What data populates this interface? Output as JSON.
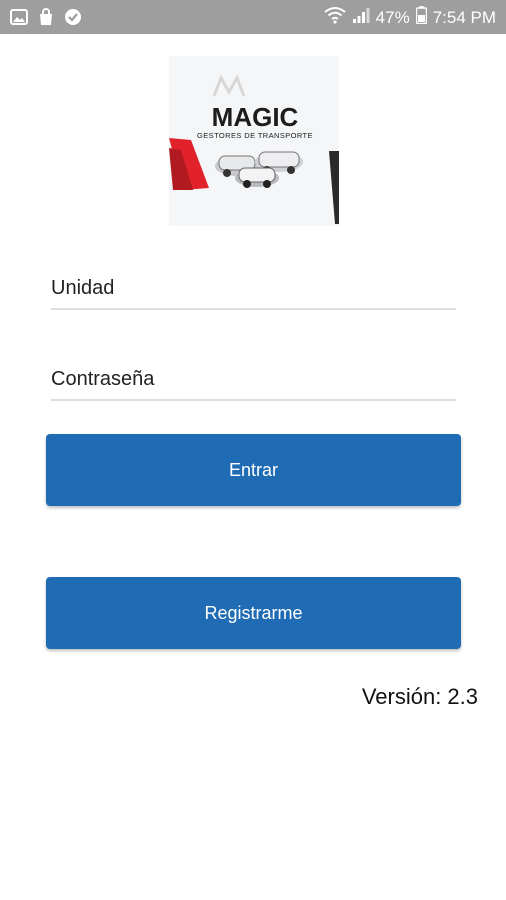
{
  "status_bar": {
    "battery_percent": "47%",
    "time": "7:54 PM",
    "left_icons": [
      "gallery-icon",
      "shopping-bag-icon",
      "check-circle-icon"
    ],
    "right_icons": [
      "wifi-icon",
      "signal-icon",
      "battery-icon"
    ]
  },
  "logo": {
    "brand": "MAGIC",
    "tagline": "GESTORES DE TRANSPORTE"
  },
  "form": {
    "unidad_placeholder": "Unidad",
    "password_placeholder": "Contraseña"
  },
  "buttons": {
    "login_label": "Entrar",
    "register_label": "Registrarme"
  },
  "version_text": "Versión: 2.3",
  "colors": {
    "status_bar": "#9e9e9e",
    "button": "#1f6cb5",
    "logo_red": "#e1222a"
  }
}
